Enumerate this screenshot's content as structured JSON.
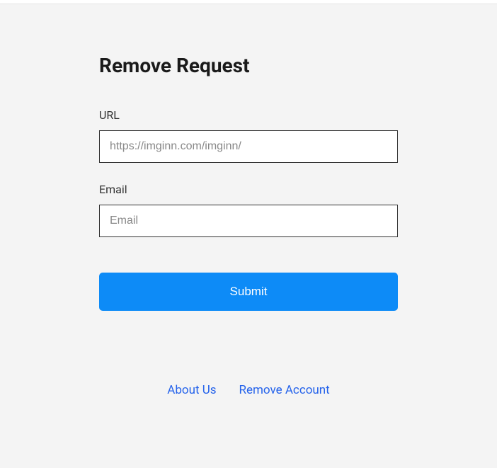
{
  "page": {
    "title": "Remove Request"
  },
  "form": {
    "url": {
      "label": "URL",
      "placeholder": "https://imginn.com/imginn/",
      "value": ""
    },
    "email": {
      "label": "Email",
      "placeholder": "Email",
      "value": ""
    },
    "submit_label": "Submit"
  },
  "footer": {
    "links": {
      "about": "About Us",
      "remove_account": "Remove Account"
    }
  }
}
